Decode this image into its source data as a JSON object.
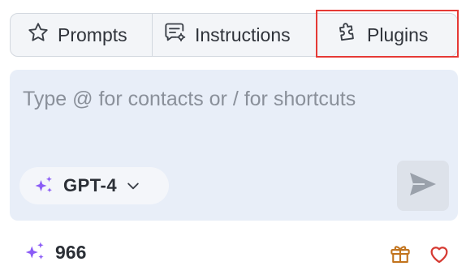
{
  "tabs": [
    {
      "label": "Prompts",
      "icon": "star-icon"
    },
    {
      "label": "Instructions",
      "icon": "message-settings-icon"
    },
    {
      "label": "Plugins",
      "icon": "puzzle-icon"
    }
  ],
  "highlighted_tab": "Plugins",
  "composer": {
    "placeholder": "Type @ for contacts or / for shortcuts",
    "value": ""
  },
  "model": {
    "label": "GPT-4",
    "icon": "sparkle-icon"
  },
  "send": {
    "icon": "send-icon"
  },
  "footer": {
    "credits": "966",
    "credits_icon": "sparkle-icon",
    "gift_icon": "gift-icon",
    "heart_icon": "heart-icon"
  },
  "colors": {
    "accent_purple": "#8b5cf6",
    "highlight_red": "#e53935",
    "gift_orange": "#c2741e",
    "heart_red": "#d63a32",
    "composer_bg": "#e8eef8"
  }
}
